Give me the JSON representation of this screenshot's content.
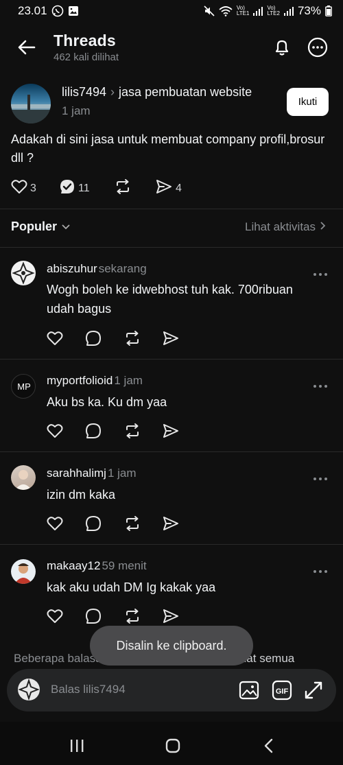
{
  "status_bar": {
    "time": "23.01",
    "battery": "73%",
    "sim1": "LTE1",
    "sim2": "LTE2"
  },
  "header": {
    "title": "Threads",
    "views": "462 kali dilihat"
  },
  "post": {
    "username": "lilis7494",
    "topic": "jasa pembuatan website",
    "time": "1 jam",
    "follow_label": "Ikuti",
    "text": "Adakah di sini jasa untuk membuat company profil,brosur dll ?",
    "likes": "3",
    "replies": "11",
    "shares": "4"
  },
  "sort": {
    "label": "Populer",
    "activity_link": "Lihat aktivitas"
  },
  "comments": [
    {
      "username": "abiszuhur",
      "time": "sekarang",
      "text": "Wogh boleh ke idwebhost tuh kak. 700ribuan udah bagus"
    },
    {
      "username": "myportfolioid",
      "time": "1 jam",
      "text": "Aku bs ka. Ku dm yaa"
    },
    {
      "username": "sarahhalimj",
      "time": "1 jam",
      "text": "izin dm kaka"
    },
    {
      "username": "makaay12",
      "time": "59 menit",
      "text": "kak aku udah DM Ig kakak yaa"
    }
  ],
  "hidden_note": {
    "text": "Beberapa balasan sudah disembunyikan.",
    "link": "Lihat semua"
  },
  "toast": "Disalin ke clipboard.",
  "reply_bar": {
    "placeholder": "Balas lilis7494"
  },
  "colors": {
    "background": "#101010",
    "muted_text": "#8a8d91",
    "toast_bg": "#4a4a4c"
  }
}
